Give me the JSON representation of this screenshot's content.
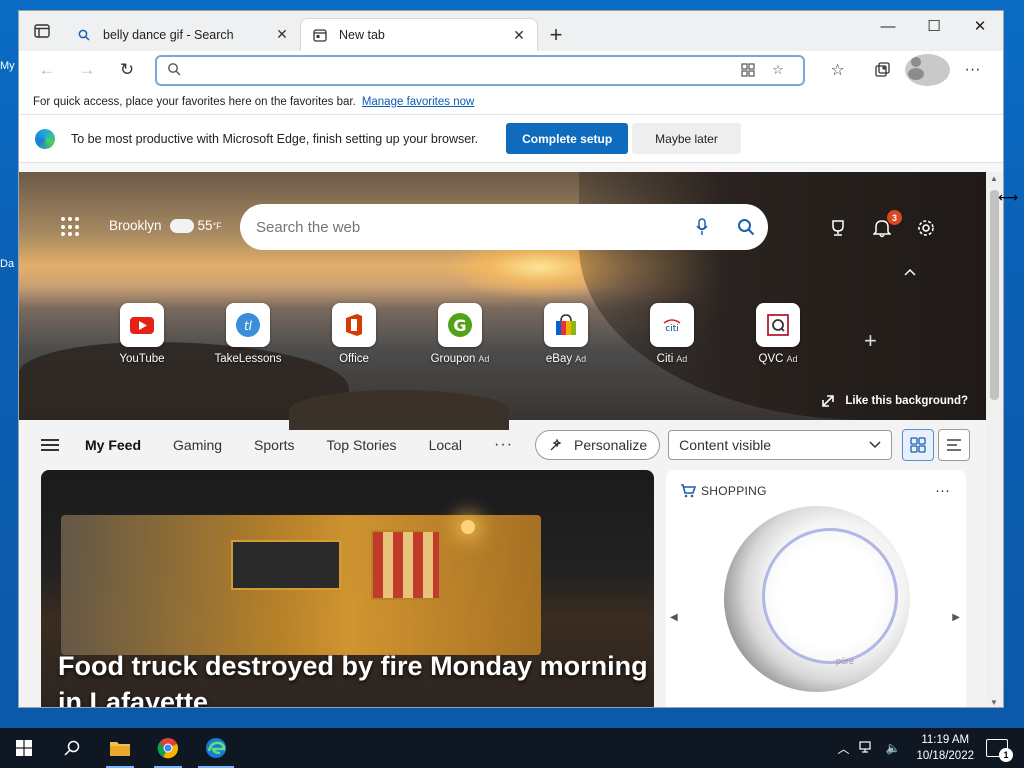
{
  "desktop": {
    "label_1": "My",
    "label_2": "Da"
  },
  "tabs": [
    {
      "label": "belly dance gif - Search",
      "icon": "search-icon",
      "active": false
    },
    {
      "label": "New tab",
      "icon": "newtab-icon",
      "active": true
    }
  ],
  "address_bar": {
    "value": "",
    "placeholder": ""
  },
  "favorites_bar": {
    "text": "For quick access, place your favorites here on the favorites bar.",
    "link": "Manage favorites now"
  },
  "setup_bar": {
    "message": "To be most productive with Microsoft Edge, finish setting up your browser.",
    "primary_button": "Complete setup",
    "secondary_button": "Maybe later"
  },
  "ntp": {
    "weather": {
      "city": "Brooklyn",
      "temp": "55",
      "unit": "°F"
    },
    "search_placeholder": "Search the web",
    "notification_count": "3",
    "quick_links": [
      {
        "label": "YouTube",
        "ad": "",
        "icon": "youtube-icon"
      },
      {
        "label": "TakeLessons",
        "ad": "",
        "icon": "takelessons-icon"
      },
      {
        "label": "Office",
        "ad": "",
        "icon": "office-icon"
      },
      {
        "label": "Groupon",
        "ad": "Ad",
        "icon": "groupon-icon"
      },
      {
        "label": "eBay",
        "ad": "Ad",
        "icon": "ebay-icon"
      },
      {
        "label": "Citi",
        "ad": "Ad",
        "icon": "citi-icon"
      },
      {
        "label": "QVC",
        "ad": "Ad",
        "icon": "qvc-icon"
      }
    ],
    "like_background": "Like this background?",
    "feed": {
      "tabs": [
        "My Feed",
        "Gaming",
        "Sports",
        "Top Stories",
        "Local"
      ],
      "more": "···",
      "personalize": "Personalize",
      "content_dropdown": "Content visible"
    },
    "main_card": {
      "headline": "Food truck destroyed by fire Monday morning in Lafayette"
    },
    "shopping_card": {
      "title": "SHOPPING",
      "more": "···",
      "brand": "pūre"
    }
  },
  "taskbar": {
    "time": "11:19 AM",
    "date": "10/18/2022",
    "notification_count": "1"
  },
  "colors": {
    "accent": "#0f6cbd",
    "taskbar": "#0f1822",
    "badge": "#d9471f"
  }
}
